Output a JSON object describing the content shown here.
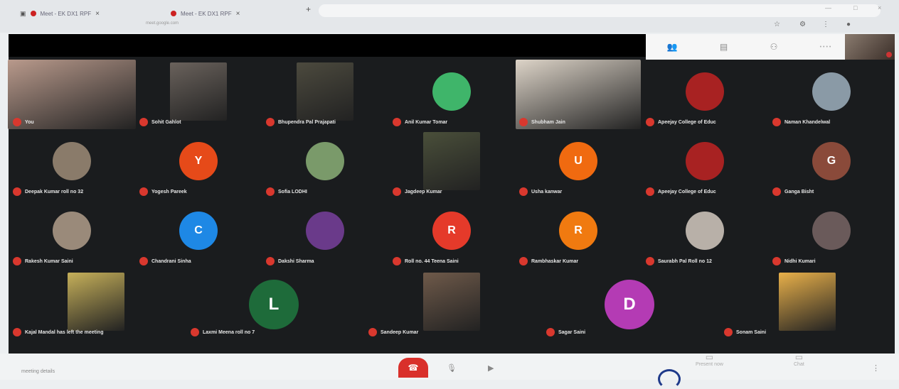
{
  "browser": {
    "tabs": [
      {
        "label": "Meet - EK DX1 RPF"
      },
      {
        "label": "Meet - EK DX1 RPF"
      }
    ],
    "tab_sub": "meet.google.com"
  },
  "meeting": {
    "participants": [
      {
        "name": "You",
        "kind": "video",
        "bg": "#b99a8c"
      },
      {
        "name": "Sohit Gahlot",
        "kind": "video",
        "bg": "#6a625c"
      },
      {
        "name": "Bhupendra Pal Prajapati",
        "kind": "video",
        "bg": "#4c4a3e"
      },
      {
        "name": "Anil Kumar Tomar",
        "kind": "avatar",
        "initial": "",
        "color": "#3fb56a"
      },
      {
        "name": "Shubham Jain",
        "kind": "video",
        "bg": "#ddd4c8"
      },
      {
        "name": "Apeejay College of Educ",
        "kind": "avatar",
        "initial": "",
        "color": "#a82222"
      },
      {
        "name": "Naman Khandelwal",
        "kind": "avatar",
        "initial": "",
        "color": "#8a9aa6"
      },
      {
        "name": "Deepak Kumar roll no 32",
        "kind": "avatar",
        "initial": "",
        "color": "#8a7b6a"
      },
      {
        "name": "Yogesh Pareek",
        "kind": "avatar",
        "initial": "Y",
        "color": "#e64a19"
      },
      {
        "name": "Sofia LODHI",
        "kind": "avatar",
        "initial": "",
        "color": "#7a9a6a"
      },
      {
        "name": "Jagdeep Kumar",
        "kind": "video",
        "bg": "#4a4f3a"
      },
      {
        "name": "Usha kanwar",
        "kind": "avatar",
        "initial": "U",
        "color": "#f06a10"
      },
      {
        "name": "Apeejay College of Educ",
        "kind": "avatar",
        "initial": "",
        "color": "#a82222"
      },
      {
        "name": "Ganga Bisht",
        "kind": "avatar",
        "initial": "G",
        "color": "#8a4a3a"
      },
      {
        "name": "Rakesh Kumar Saini",
        "kind": "avatar",
        "initial": "",
        "color": "#9a8a7a"
      },
      {
        "name": "Chandrani Sinha",
        "kind": "avatar",
        "initial": "C",
        "color": "#1e88e5"
      },
      {
        "name": "Dakshi Sharma",
        "kind": "avatar",
        "initial": "",
        "color": "#6a3a8a"
      },
      {
        "name": "Roll no. 44 Teena Saini",
        "kind": "avatar",
        "initial": "R",
        "color": "#e53a2a"
      },
      {
        "name": "Rambhaskar Kumar",
        "kind": "avatar",
        "initial": "R",
        "color": "#f07a10"
      },
      {
        "name": "Saurabh Pal Roll no 12",
        "kind": "avatar",
        "initial": "",
        "color": "#b8b0a8"
      },
      {
        "name": "Nidhi Kumari",
        "kind": "avatar",
        "initial": "",
        "color": "#6a5a5a"
      },
      {
        "name": "Kajal Mandal has left the meeting",
        "kind": "video",
        "bg": "#c6b05a"
      },
      {
        "name": "Laxmi Meena roll no 7",
        "kind": "avatar",
        "initial": "L",
        "color": "#1e6b3a"
      },
      {
        "name": "Sandeep Kumar",
        "kind": "video",
        "bg": "#6f5a4a"
      },
      {
        "name": "Sagar Saini",
        "kind": "avatar",
        "initial": "D",
        "color": "#b43bb4"
      },
      {
        "name": "Sonam Saini",
        "kind": "video",
        "bg": "#e8b04a"
      }
    ],
    "left_note": "Kajal Mandal"
  },
  "bottom": {
    "meeting_code": "meeting details",
    "present": "Present now",
    "chat": "Chat"
  }
}
